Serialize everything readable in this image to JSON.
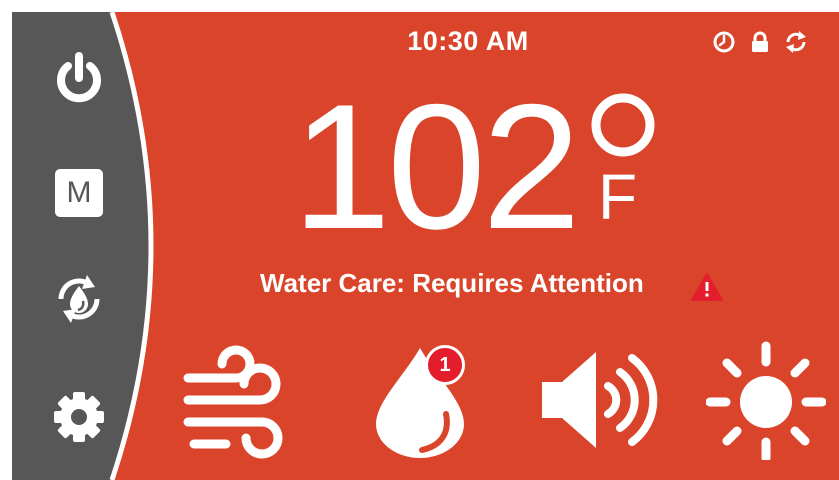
{
  "colors": {
    "background": "#d9442b",
    "sidebar": "#575757",
    "alert": "#e31d2b",
    "foreground": "#ffffff"
  },
  "status_bar": {
    "time": "10:30 AM",
    "icons": [
      "clock-icon",
      "lock-icon",
      "sync-icon"
    ]
  },
  "temperature": {
    "value": "102",
    "unit": "F"
  },
  "water_care": {
    "status": "Water Care: Requires Attention",
    "alert_icon": "warning-icon"
  },
  "sidebar": {
    "items": [
      {
        "icon": "power-icon"
      },
      {
        "icon": "mode-icon",
        "label": "M"
      },
      {
        "icon": "water-cycle-icon"
      },
      {
        "icon": "gear-icon"
      }
    ]
  },
  "controls": [
    {
      "icon": "wind-icon"
    },
    {
      "icon": "water-drop-icon",
      "badge": "1"
    },
    {
      "icon": "speaker-icon"
    },
    {
      "icon": "light-icon"
    }
  ]
}
